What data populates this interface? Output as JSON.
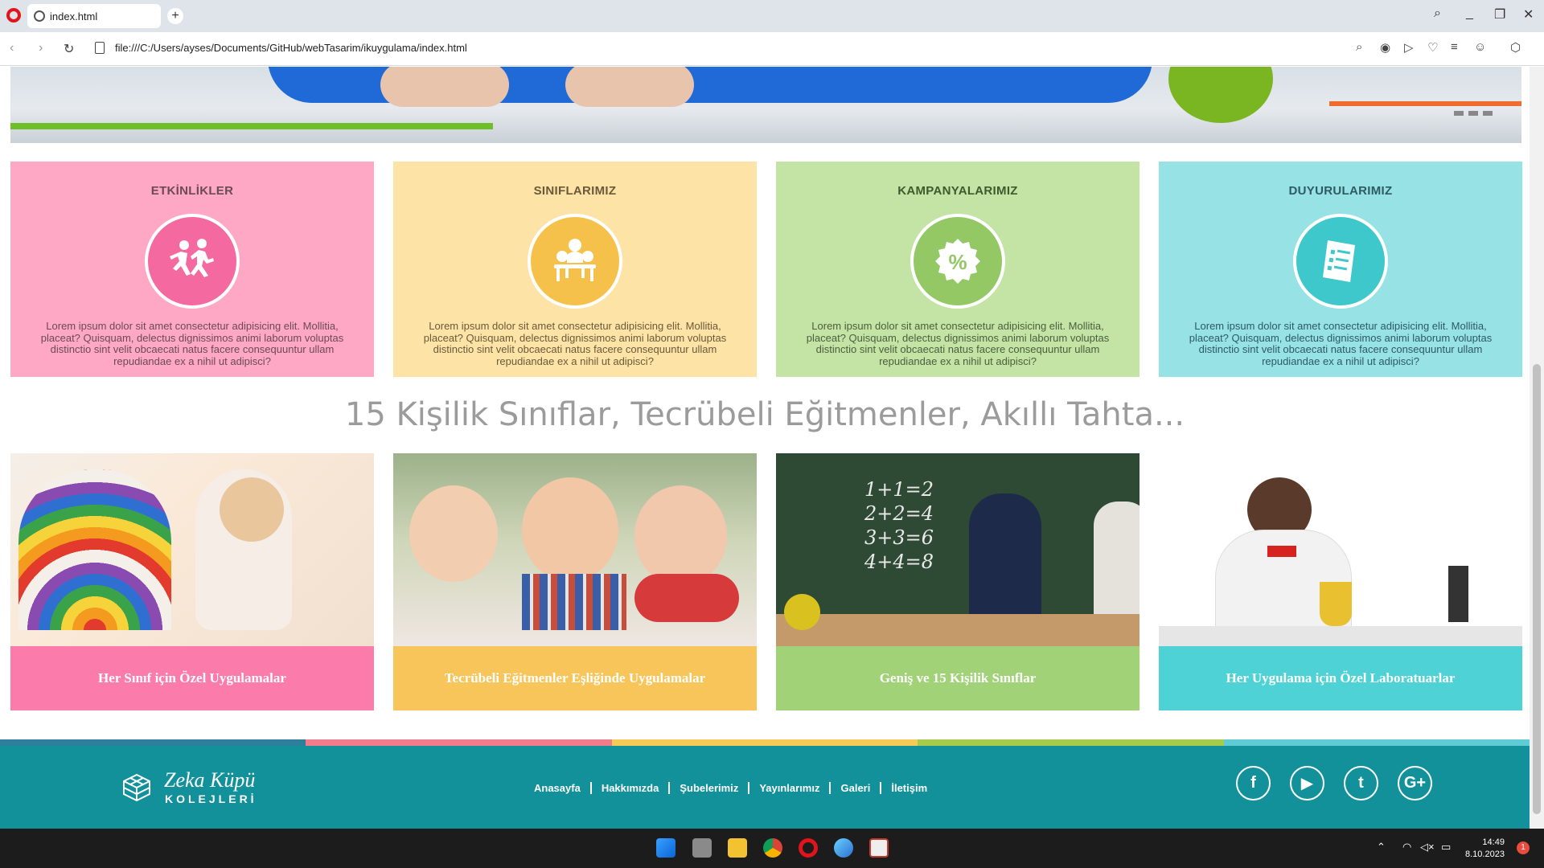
{
  "browser": {
    "tab_title": "index.html",
    "new_tab": "+",
    "url": "file:///C:/Users/ayses/Documents/GitHub/webTasarim/ikuygulama/index.html"
  },
  "cards": [
    {
      "title": "ETKİNLİKLER",
      "text": "Lorem ipsum dolor sit amet consectetur adipisicing elit. Mollitia, placeat? Quisquam, delectus dignissimos animi laborum voluptas distinctio sint velit obcaecati natus facere consequuntur ullam repudiandae ex a nihil ut adipisci?",
      "bg": "#fea8c6",
      "accent": "#f46aa0",
      "title_color": "#6b4a55",
      "text_color": "#6b4a55",
      "icon": "running-children-icon"
    },
    {
      "title": "SINIFLARIMIZ",
      "text": "Lorem ipsum dolor sit amet consectetur adipisicing elit. Mollitia, placeat? Quisquam, delectus dignissimos animi laborum voluptas distinctio sint velit obcaecati natus facere consequuntur ullam repudiandae ex a nihil ut adipisci?",
      "bg": "#fde3a6",
      "accent": "#f6c14a",
      "title_color": "#6a5a3a",
      "text_color": "#6a5a3a",
      "icon": "students-desk-icon"
    },
    {
      "title": "KAMPANYALARIMIZ",
      "text": "Lorem ipsum dolor sit amet consectetur adipisicing elit. Mollitia, placeat? Quisquam, delectus dignissimos animi laborum voluptas distinctio sint velit obcaecati natus facere consequuntur ullam repudiandae ex a nihil ut adipisci?",
      "bg": "#c3e4a4",
      "accent": "#93c865",
      "title_color": "#3d5a2e",
      "text_color": "#4d5e3e",
      "icon": "discount-badge-icon"
    },
    {
      "title": "DUYURULARIMIZ",
      "text": "Lorem ipsum dolor sit amet consectetur adipisicing elit. Mollitia, placeat? Quisquam, delectus dignissimos animi laborum voluptas distinctio sint velit obcaecati natus facere consequuntur ullam repudiandae ex a nihil ut adipisci?",
      "bg": "#96e2e5",
      "accent": "#3ec8cc",
      "title_color": "#2e5a63",
      "text_color": "#2e5a63",
      "icon": "announcement-list-icon"
    }
  ],
  "headline": "15 Kişilik Sınıflar, Tecrübeli Eğitmenler, Akıllı Tahta...",
  "features": [
    {
      "caption": "Her Sınıf için Özel Uygulamalar",
      "color": "#fb7bab"
    },
    {
      "caption": "Tecrübeli Eğitmenler Eşliğinde Uygulamalar",
      "color": "#f8c55a"
    },
    {
      "caption": "Geniş ve 15 Kişilik Sınıflar",
      "color": "#a1d277"
    },
    {
      "caption": "Her Uygulama için Özel Laboratuarlar",
      "color": "#4fd2d5"
    }
  ],
  "strip_colors": [
    "#2e7f9b",
    "#f27c8c",
    "#f6cb55",
    "#a7cc4b",
    "#5fcbd5",
    "#12919b"
  ],
  "footer": {
    "logo_name": "Zeka Küpü",
    "logo_sub": "KOLEJLERİ",
    "nav": [
      "Anasayfa",
      "Hakkımızda",
      "Şubelerimiz",
      "Yayınlarımız",
      "Galeri",
      "İletişim"
    ],
    "social": [
      "f",
      "▶",
      "t",
      "G+"
    ],
    "bg": "#12919b"
  },
  "taskbar": {
    "time": "14:49",
    "date": "8.10.2023",
    "notifications": "1"
  }
}
